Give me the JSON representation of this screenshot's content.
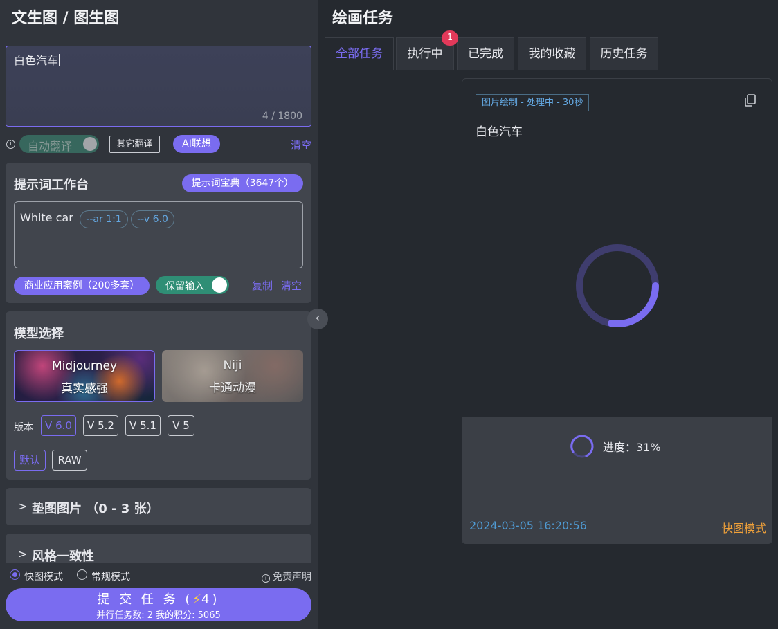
{
  "left": {
    "title": "文生图 / 图生图",
    "prompt": {
      "value": "白色汽车",
      "count": "4 / 1800"
    },
    "translate_row": {
      "info_icon": "ⓘ",
      "auto_translate": "自动翻译",
      "other_translate": "其它翻译",
      "ai_assoc": "AI联想",
      "clear": "清空"
    },
    "workbench": {
      "title": "提示词工作台",
      "dict_button": "提示词宝典（3647个）",
      "text": "White car",
      "tags": [
        "--ar 1:1",
        "--v 6.0"
      ],
      "cases_button": "商业应用案例（200多套）",
      "keep_input": "保留输入",
      "copy": "复制",
      "clear": "清空"
    },
    "model": {
      "title": "模型选择",
      "cards": [
        {
          "name": "Midjourney",
          "sub": "真实感强"
        },
        {
          "name": "Niji",
          "sub": "卡通动漫"
        }
      ],
      "version_label": "版本",
      "versions": [
        "V 6.0",
        "V 5.2",
        "V 5.1",
        "V 5"
      ],
      "styles": [
        "默认",
        "RAW"
      ]
    },
    "pad_images": {
      "chevron": ">",
      "title": "垫图图片 （0 - 3 张）"
    },
    "style_consistency": {
      "chevron": ">",
      "title": "风格一致性"
    },
    "bottom": {
      "mode_fast": "快图模式",
      "mode_normal": "常规模式",
      "disclaimer": "免责声明",
      "submit": {
        "label_prefix": "提 交 任 务 (",
        "bolt": "⚡",
        "label_suffix": "4)",
        "sub": "并行任务数: 2     我的积分: 5065"
      }
    },
    "collapse_icon": "‹"
  },
  "right": {
    "title": "绘画任务",
    "tabs": [
      "全部任务",
      "执行中",
      "已完成",
      "我的收藏",
      "历史任务"
    ],
    "badge": "1",
    "task": {
      "status": "图片绘制 - 处理中 - 30秒",
      "prompt": "白色汽车",
      "progress_label": "进度：31%",
      "progress_fraction": 0.31,
      "timestamp": "2024-03-05 16:20:56",
      "mode": "快图模式"
    }
  },
  "colors": {
    "accent": "#7a6cf0",
    "toggle_on": "#2f8e75",
    "badge": "#e2395a",
    "timestamp": "#4f9bd4",
    "mode": "#f0a13a"
  }
}
